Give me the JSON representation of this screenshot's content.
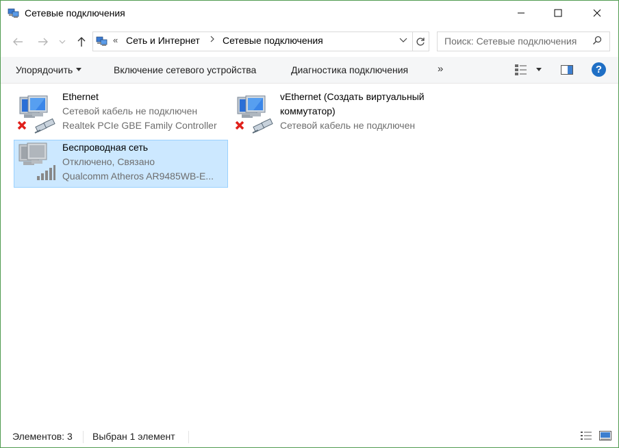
{
  "window": {
    "title": "Сетевые подключения"
  },
  "address": {
    "overflow": "«",
    "crumbs": [
      "Сеть и Интернет",
      "Сетевые подключения"
    ],
    "search_placeholder": "Поиск: Сетевые подключения"
  },
  "toolbar": {
    "organize_label": "Упорядочить",
    "enable_label": "Включение сетевого устройства",
    "diagnose_label": "Диагностика подключения",
    "more_label": "»",
    "help_label": "?"
  },
  "connections": [
    {
      "name": "Ethernet",
      "status": "Сетевой кабель не подключен",
      "device": "Realtek PCIe GBE Family Controller",
      "icon": "wired-network-disconnected-icon",
      "selected": false
    },
    {
      "name_line1": "vEthernet (Создать виртуальный",
      "name_line2": "коммутатор)",
      "status": "Сетевой кабель не подключен",
      "icon": "wired-network-disconnected-icon",
      "selected": false
    },
    {
      "name": "Беспроводная сеть",
      "status": "Отключено, Связано",
      "device": "Qualcomm Atheros AR9485WB-E...",
      "icon": "wireless-network-disabled-icon",
      "selected": true
    }
  ],
  "statusbar": {
    "count": "Элементов: 3",
    "selected": "Выбран 1 элемент"
  },
  "colors": {
    "window_border": "#4f9a4f",
    "selection_bg": "#cce8ff",
    "selection_border": "#99d1ff",
    "help_blue": "#1f6fc5",
    "error_red": "#e0201b"
  }
}
